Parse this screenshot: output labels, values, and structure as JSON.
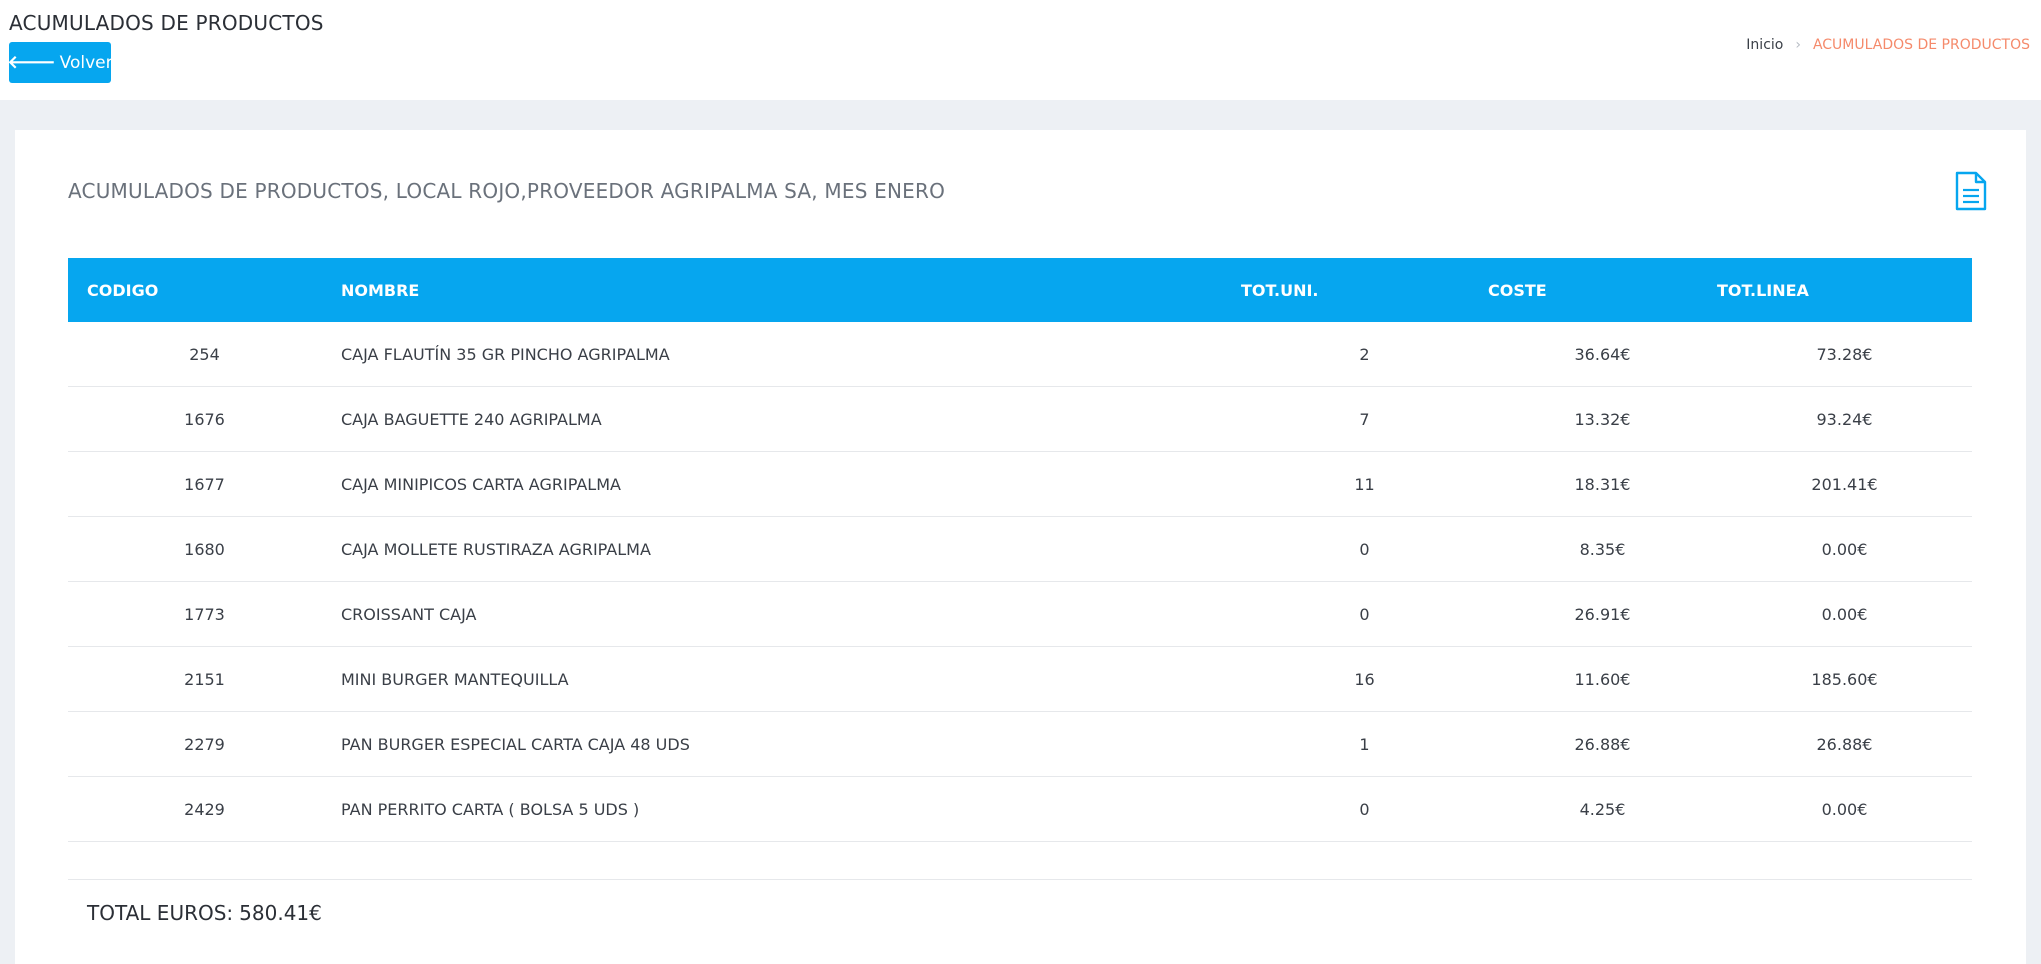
{
  "header": {
    "title": "ACUMULADOS DE PRODUCTOS",
    "back_label": "Volver"
  },
  "breadcrumb": {
    "home": "Inicio",
    "current": "ACUMULADOS DE PRODUCTOS"
  },
  "report": {
    "title": "ACUMULADOS DE PRODUCTOS, LOCAL ROJO,PROVEEDOR AGRIPALMA SA, MES ENERO",
    "export_icon": "document-icon",
    "columns": {
      "code": "CODIGO",
      "name": "NOMBRE",
      "units": "TOT.UNI.",
      "cost": "COSTE",
      "total": "TOT.LINEA"
    },
    "rows": [
      {
        "code": "254",
        "name": "CAJA FLAUTÍN 35 GR PINCHO AGRIPALMA",
        "units": "2",
        "cost": "36.64€",
        "total": "73.28€"
      },
      {
        "code": "1676",
        "name": "CAJA BAGUETTE 240 AGRIPALMA",
        "units": "7",
        "cost": "13.32€",
        "total": "93.24€"
      },
      {
        "code": "1677",
        "name": "CAJA MINIPICOS CARTA AGRIPALMA",
        "units": "11",
        "cost": "18.31€",
        "total": "201.41€"
      },
      {
        "code": "1680",
        "name": "CAJA MOLLETE RUSTIRAZA AGRIPALMA",
        "units": "0",
        "cost": "8.35€",
        "total": "0.00€"
      },
      {
        "code": "1773",
        "name": "CROISSANT CAJA",
        "units": "0",
        "cost": "26.91€",
        "total": "0.00€"
      },
      {
        "code": "2151",
        "name": "MINI BURGER MANTEQUILLA",
        "units": "16",
        "cost": "11.60€",
        "total": "185.60€"
      },
      {
        "code": "2279",
        "name": "PAN BURGER ESPECIAL CARTA CAJA 48 UDS",
        "units": "1",
        "cost": "26.88€",
        "total": "26.88€"
      },
      {
        "code": "2429",
        "name": "PAN PERRITO CARTA ( BOLSA 5 UDS )",
        "units": "0",
        "cost": "4.25€",
        "total": "0.00€"
      }
    ],
    "total_label": "TOTAL EUROS:",
    "total_value": "580.41€"
  },
  "colors": {
    "accent": "#06a6ef",
    "breadcrumb_active": "#f58a6b",
    "background": "#edf0f4"
  }
}
